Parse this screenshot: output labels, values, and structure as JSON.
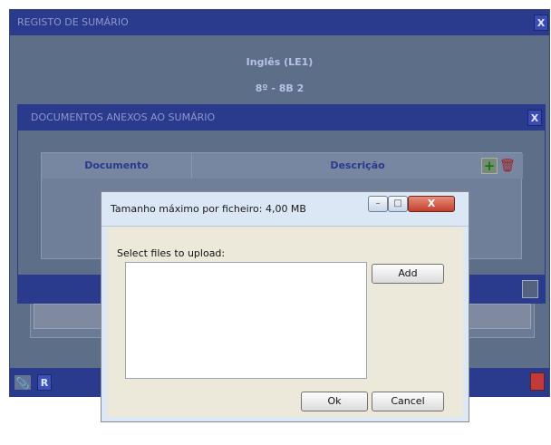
{
  "outer_dialog": {
    "title": "REGISTO DE SUMÁRIO",
    "close": "X",
    "subject": "Inglês (LE1)",
    "class": "8º - 8B 2",
    "r_button": "R"
  },
  "attachments_dialog": {
    "title": "DOCUMENTOS ANEXOS AO SUMÁRIO",
    "close": "X",
    "columns": [
      "Documento",
      "Descrição"
    ]
  },
  "upload_popup": {
    "title": "Tamanho máximo por ficheiro: 4,00 MB",
    "select_label": "Select files to upload:",
    "add_label": "Add",
    "ok_label": "Ok",
    "cancel_label": "Cancel",
    "minimize": "–",
    "maximize": "□",
    "close": "X"
  }
}
